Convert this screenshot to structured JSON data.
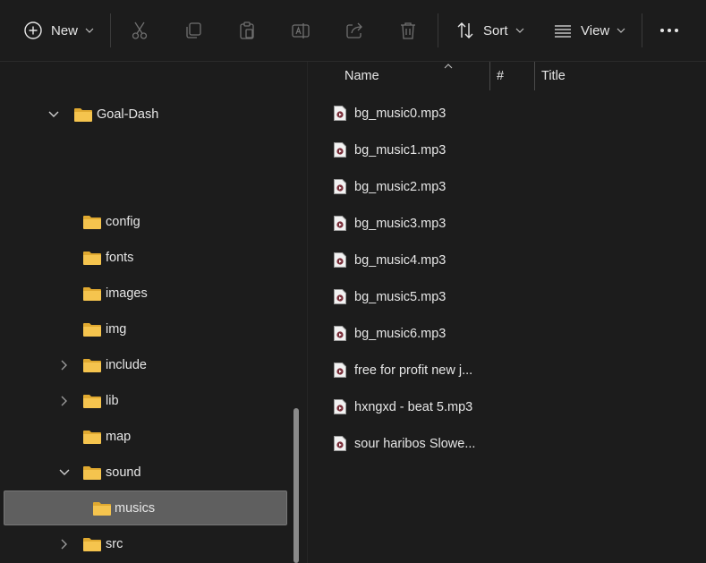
{
  "toolbar": {
    "new_label": "New",
    "sort_label": "Sort",
    "view_label": "View"
  },
  "sidebar": {
    "root": "Goal-Dash",
    "items": [
      {
        "label": "config",
        "expandable": false
      },
      {
        "label": "fonts",
        "expandable": false
      },
      {
        "label": "images",
        "expandable": false
      },
      {
        "label": "img",
        "expandable": false
      },
      {
        "label": "include",
        "expandable": true
      },
      {
        "label": "lib",
        "expandable": true
      },
      {
        "label": "map",
        "expandable": false
      },
      {
        "label": "sound",
        "expandable": true,
        "expanded": true
      },
      {
        "label": "musics",
        "expandable": false,
        "selected": true
      },
      {
        "label": "src",
        "expandable": true
      }
    ]
  },
  "columns": {
    "name": "Name",
    "number": "#",
    "title": "Title"
  },
  "files": [
    "bg_music0.mp3",
    "bg_music1.mp3",
    "bg_music2.mp3",
    "bg_music3.mp3",
    "bg_music4.mp3",
    "bg_music5.mp3",
    "bg_music6.mp3",
    "free for profit new j...",
    "hxngxd - beat 5.mp3",
    "sour haribos Slowe..."
  ],
  "colors": {
    "background": "#1c1c1c",
    "folder": "#f5c44e",
    "selection": "#5f5f5f"
  }
}
